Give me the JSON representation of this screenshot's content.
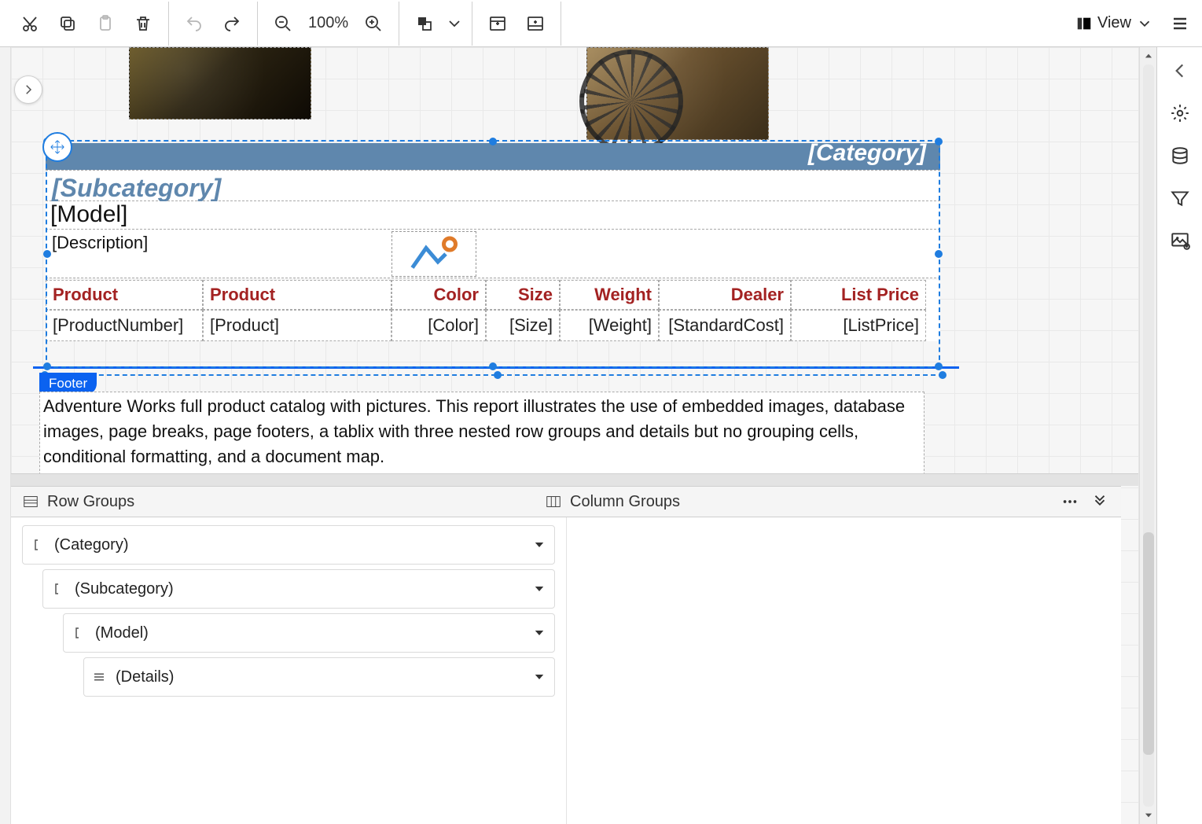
{
  "toolbar": {
    "zoom_label": "100%",
    "view_label": "View"
  },
  "design": {
    "category_placeholder": "[Category]",
    "subcategory_placeholder": "[Subcategory]",
    "model_placeholder": "[Model]",
    "description_placeholder": "[Description]",
    "table_headers": {
      "product_number": "Product",
      "product": "Product",
      "color": "Color",
      "size": "Size",
      "weight": "Weight",
      "dealer": "Dealer",
      "list_price": "List Price"
    },
    "table_fields": {
      "product_number": "[ProductNumber]",
      "product": "[Product]",
      "color": "[Color]",
      "size": "[Size]",
      "weight": "[Weight]",
      "standard_cost": "[StandardCost]",
      "list_price": "[ListPrice]"
    },
    "footer_tag": "Footer",
    "footer_text": "Adventure Works full product catalog with pictures. This report illustrates the use of embedded images, database images, page breaks, page footers, a tablix with three nested row groups and details but no grouping cells, conditional formatting, and a document map."
  },
  "groups": {
    "row_groups_label": "Row Groups",
    "column_groups_label": "Column Groups",
    "items": [
      {
        "label": "(Category)",
        "indent": 0,
        "icon": "bracket"
      },
      {
        "label": "(Subcategory)",
        "indent": 1,
        "icon": "bracket"
      },
      {
        "label": "(Model)",
        "indent": 2,
        "icon": "bracket"
      },
      {
        "label": "(Details)",
        "indent": 3,
        "icon": "hamburger"
      }
    ]
  }
}
